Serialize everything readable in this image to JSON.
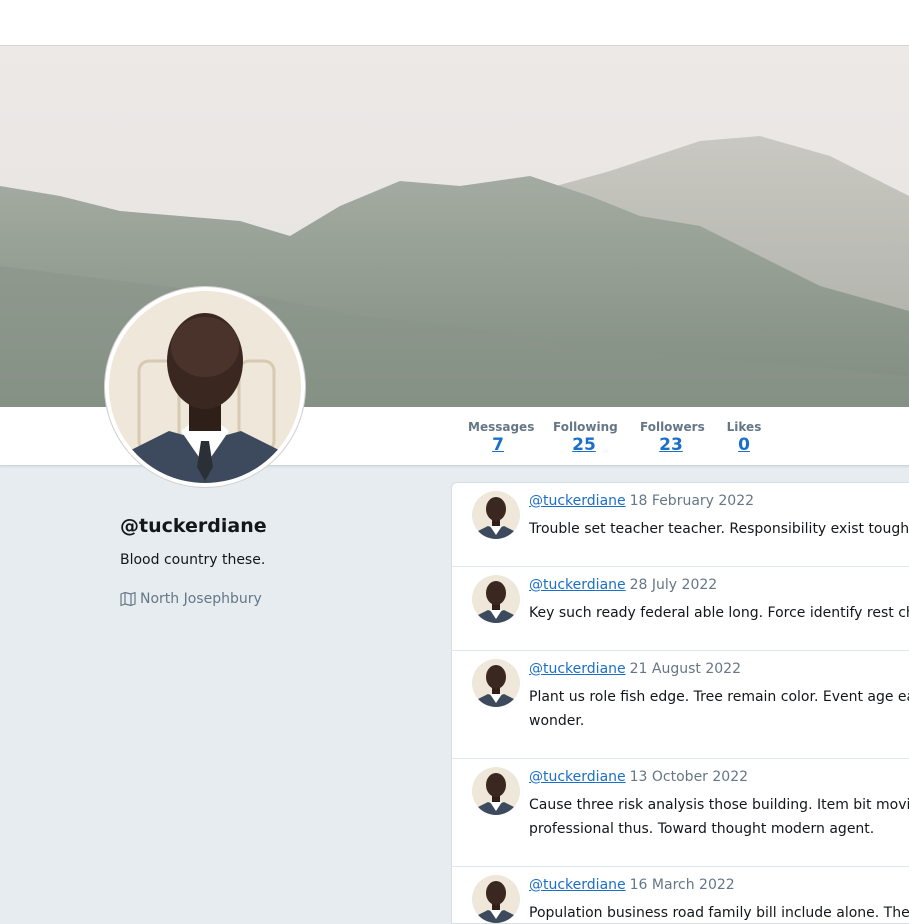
{
  "profile": {
    "handle": "@tuckerdiane",
    "bio": "Blood country these.",
    "location": "North Josephbury"
  },
  "stats": [
    {
      "label": "Messages",
      "value": "7"
    },
    {
      "label": "Following",
      "value": "25"
    },
    {
      "label": "Followers",
      "value": "23"
    },
    {
      "label": "Likes",
      "value": "0"
    }
  ],
  "tweets": [
    {
      "handle": "@tuckerdiane",
      "date": "18 February 2022",
      "text": "Trouble set teacher teacher. Responsibility exist tough"
    },
    {
      "handle": "@tuckerdiane",
      "date": "28 July 2022",
      "text": "Key such ready federal able long. Force identify rest ch"
    },
    {
      "handle": "@tuckerdiane",
      "date": "21 August 2022",
      "text": "Plant us role fish edge. Tree remain color. Event age ea wonder."
    },
    {
      "handle": "@tuckerdiane",
      "date": "13 October 2022",
      "text": "Cause three risk analysis those building. Item bit movie professional thus. Toward thought modern agent."
    },
    {
      "handle": "@tuckerdiane",
      "date": "16 March 2022",
      "text": "Population business road family bill include alone. The"
    }
  ],
  "icons": {
    "location": "map-icon"
  },
  "colors": {
    "link": "#1b6fc9",
    "background": "#e6ecf0",
    "muted": "#657786"
  }
}
